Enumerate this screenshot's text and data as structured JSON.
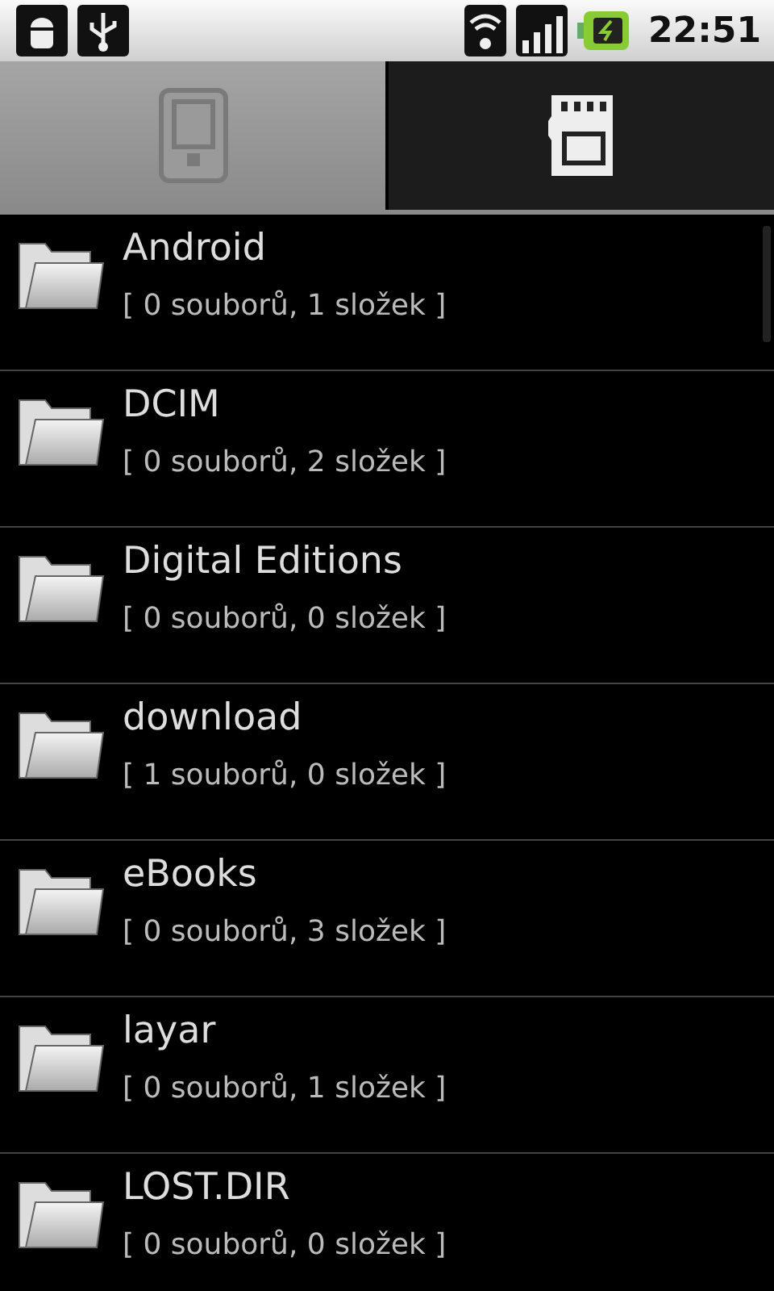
{
  "status_bar": {
    "time": "22:51"
  },
  "tabs": [
    {
      "kind": "phone",
      "selected": true
    },
    {
      "kind": "sdcard",
      "selected": false
    }
  ],
  "folders": [
    {
      "name": "Android",
      "details": "[ 0 souborů, 1 složek ]"
    },
    {
      "name": "DCIM",
      "details": "[ 0 souborů, 2 složek ]"
    },
    {
      "name": "Digital Editions",
      "details": "[ 0 souborů, 0 složek ]"
    },
    {
      "name": "download",
      "details": "[ 1 souborů, 0 složek ]"
    },
    {
      "name": "eBooks",
      "details": "[ 0 souborů, 3 složek ]"
    },
    {
      "name": "layar",
      "details": "[ 0 souborů, 1 složek ]"
    },
    {
      "name": "LOST.DIR",
      "details": "[ 0 souborů, 0 složek ]"
    }
  ]
}
